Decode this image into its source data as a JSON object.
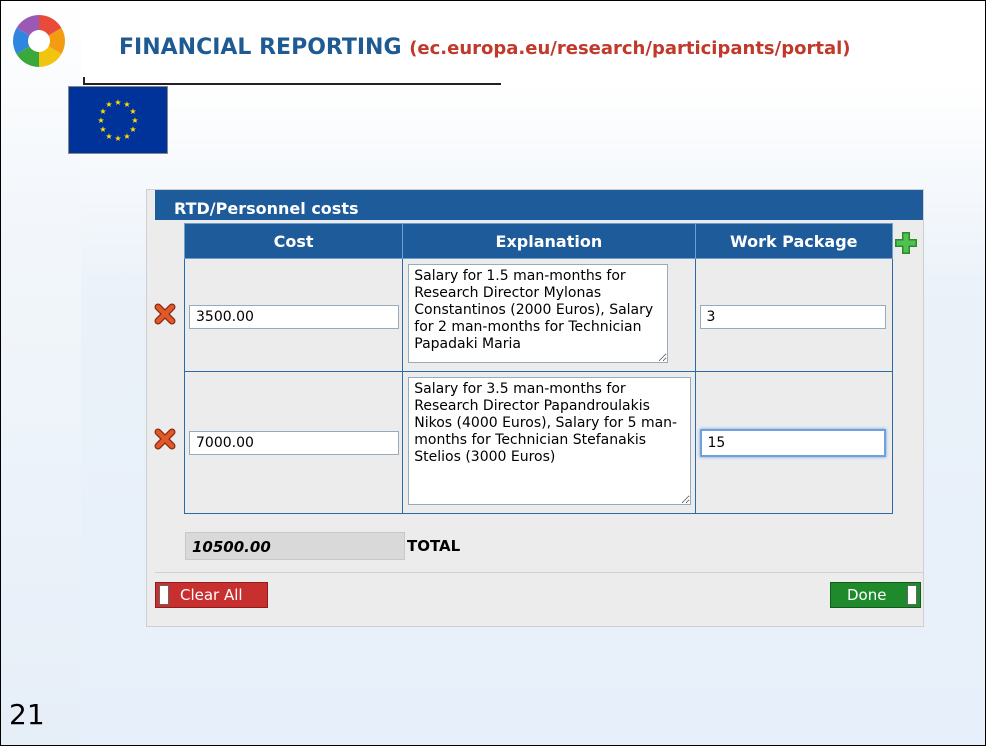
{
  "slide": {
    "title_main": "FINANCIAL REPORTING",
    "title_url": "(ec.europa.eu/research/participants/portal)",
    "number": "21"
  },
  "panel": {
    "title": "RTD/Personnel costs",
    "columns": [
      "Cost",
      "Explanation",
      "Work Package"
    ],
    "rows": [
      {
        "cost": "3500.00",
        "explanation": "Salary for 1.5 man-months for Research Director Mylonas Constantinos (2000 Euros), Salary for 2 man-months for Technician Papadaki Maria",
        "work_package": "3"
      },
      {
        "cost": "7000.00",
        "explanation": "Salary for 3.5 man-months for Research Director Papandroulakis Nikos (4000 Euros), Salary for 5 man-months for Technician Stefanakis Stelios (3000 Euros)",
        "work_package": "15"
      }
    ],
    "total_value": "10500.00",
    "total_label": "TOTAL",
    "clear_button": "Clear All",
    "done_button": "Done"
  },
  "colors": {
    "header_blue": "#1e5b9a",
    "title_blue": "#1f5b93",
    "url_red": "#c0392b",
    "clear_red": "#c82f2f",
    "done_green": "#1f8a2c",
    "add_green": "#3aa83a",
    "delete_orange": "#e0592a"
  },
  "icons": {
    "delete": "delete-x-icon",
    "add": "add-plus-icon",
    "logo": "color-wheel-logo",
    "flag": "eu-flag-icon"
  }
}
